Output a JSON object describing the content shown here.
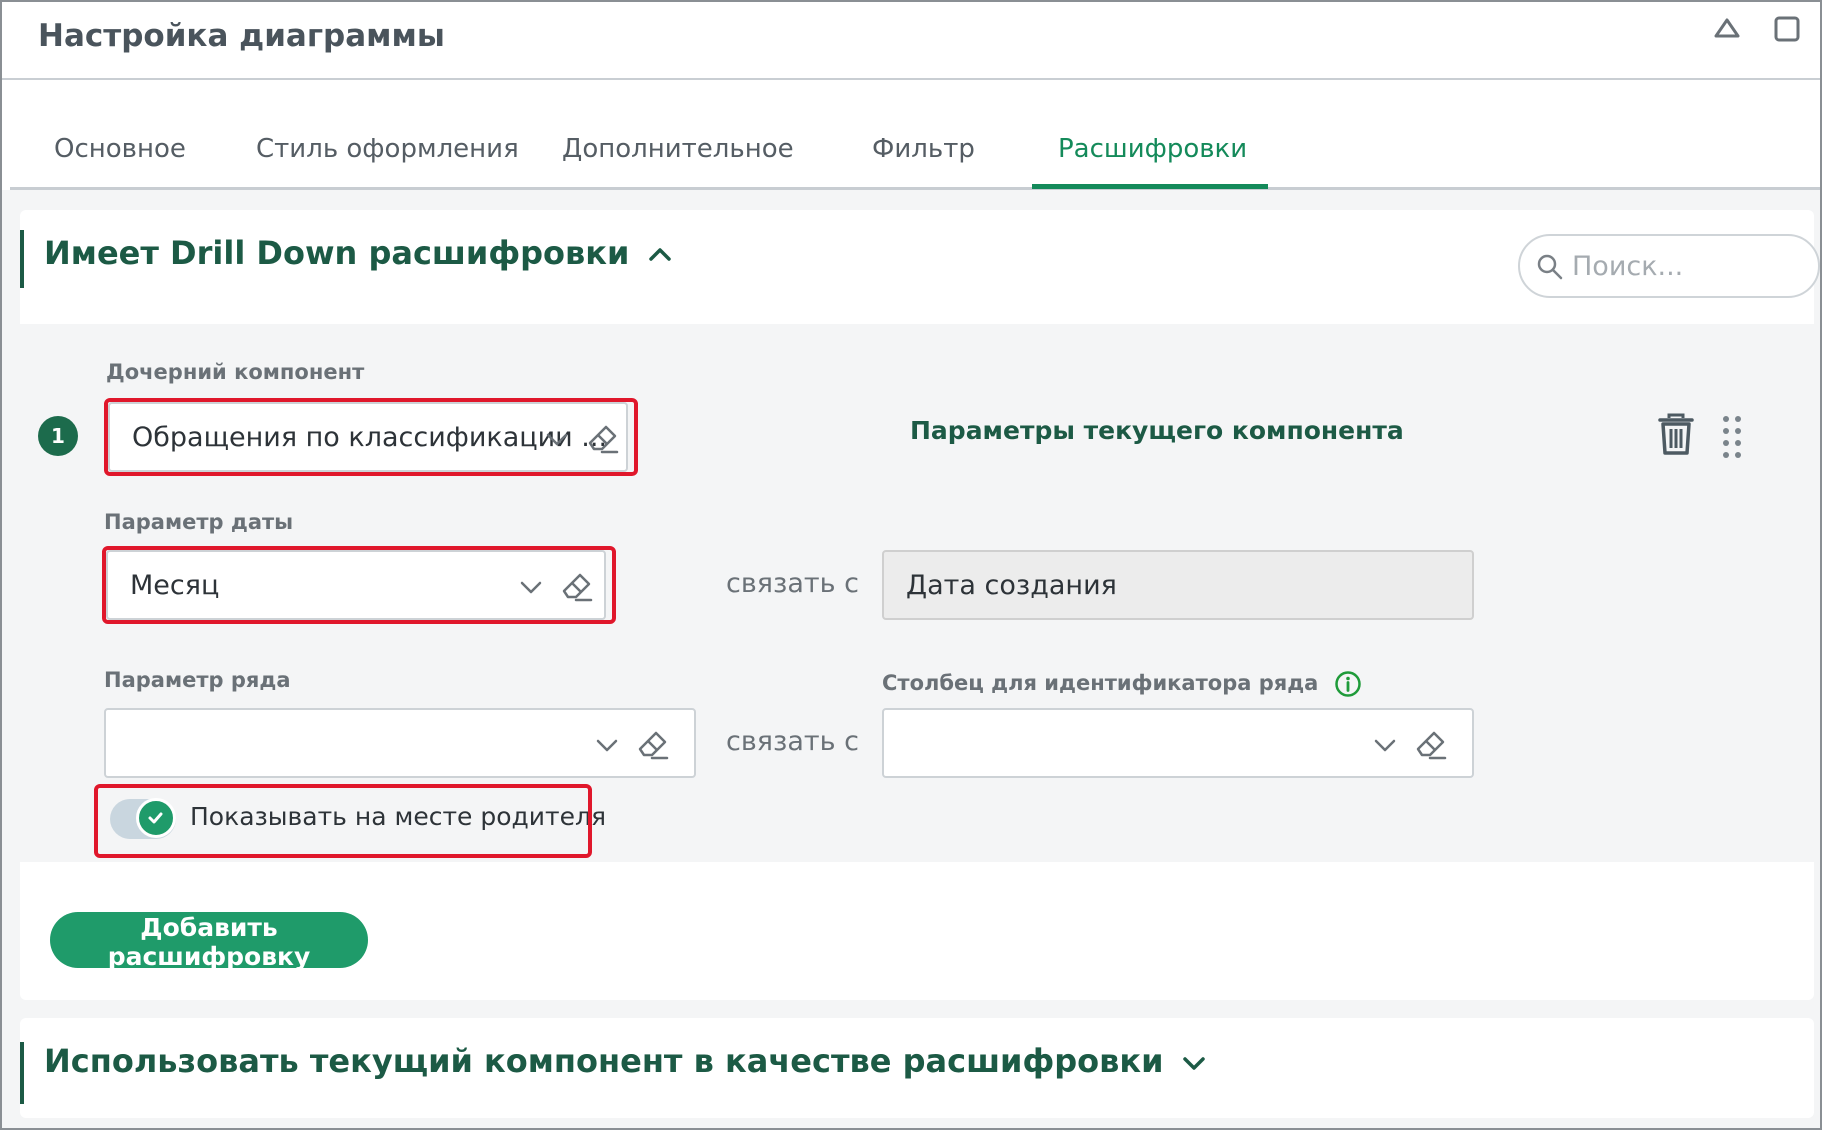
{
  "window": {
    "title": "Настройка диаграммы"
  },
  "tabs": [
    {
      "label": "Основное"
    },
    {
      "label": "Стиль оформления"
    },
    {
      "label": "Дополнительное"
    },
    {
      "label": "Фильтр"
    },
    {
      "label": "Расшифровки"
    }
  ],
  "active_tab": "Расшифровки",
  "drilldown": {
    "section_title": "Имеет Drill Down расшифровки",
    "search_placeholder": "Поиск...",
    "item_number": "1",
    "child_component_label": "Дочерний компонент",
    "child_component_value": "Обращения по классификации ...",
    "current_params_label": "Параметры текущего компонента",
    "date_param_label": "Параметр даты",
    "date_param_value": "Месяц",
    "link_with_1": "связать с",
    "date_link_value": "Дата создания",
    "series_param_label": "Параметр ряда",
    "series_param_value": "",
    "link_with_2": "связать с",
    "series_id_column_label": "Столбец для идентификатора ряда",
    "series_id_column_value": "",
    "show_in_parent_label": "Показывать на месте родителя",
    "show_in_parent_on": true,
    "add_button": "Добавить расшифровку"
  },
  "use_as_drilldown": {
    "section_title": "Использовать текущий компонент в качестве расшифровки"
  },
  "colors": {
    "accent": "#1f9b6a",
    "dark_green": "#1c5a45",
    "highlight": "#e0172b"
  }
}
